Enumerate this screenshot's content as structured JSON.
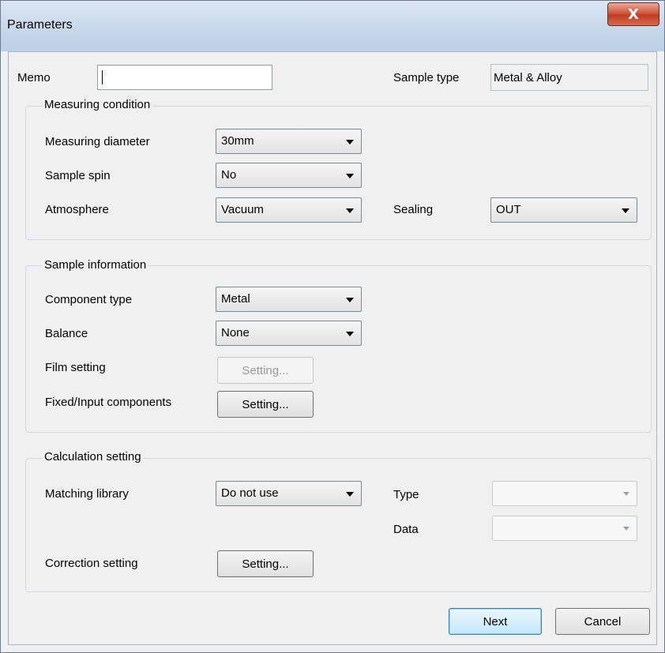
{
  "window": {
    "title": "Parameters",
    "close_glyph": "X"
  },
  "memo": {
    "label": "Memo",
    "value": ""
  },
  "sample_type": {
    "label": "Sample type",
    "value": "Metal & Alloy"
  },
  "measuring": {
    "title": "Measuring condition",
    "diameter_label": "Measuring diameter",
    "diameter_value": "30mm",
    "spin_label": "Sample spin",
    "spin_value": "No",
    "atmosphere_label": "Atmosphere",
    "atmosphere_value": "Vacuum",
    "sealing_label": "Sealing",
    "sealing_value": "OUT"
  },
  "sample_info": {
    "title": "Sample information",
    "component_label": "Component type",
    "component_value": "Metal",
    "balance_label": "Balance",
    "balance_value": "None",
    "film_label": "Film setting",
    "film_button": "Setting...",
    "fixed_label": "Fixed/Input components",
    "fixed_button": "Setting..."
  },
  "calculation": {
    "title": "Calculation setting",
    "matching_label": "Matching library",
    "matching_value": "Do not use",
    "type_label": "Type",
    "type_value": "",
    "data_label": "Data",
    "data_value": "",
    "correction_label": "Correction setting",
    "correction_button": "Setting..."
  },
  "footer": {
    "next_label": "Next",
    "cancel_label": "Cancel"
  },
  "colors": {
    "titlebar": "#c7d7ea",
    "close": "#c03c22",
    "dialog_bg": "#f0f0f0",
    "default_button_border": "#3c7fb1"
  }
}
